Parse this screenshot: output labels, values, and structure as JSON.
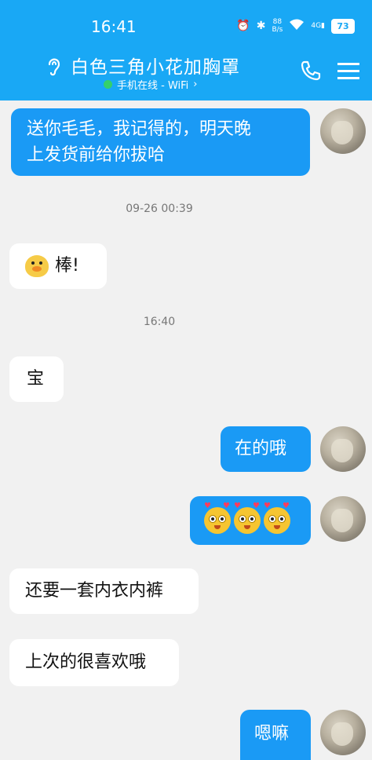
{
  "status_bar": {
    "time": "16:41",
    "net_speed_value": "88",
    "net_speed_unit": "B/s",
    "network": "4G",
    "battery": "73"
  },
  "header": {
    "title": "白色三角小花加胸罩",
    "online_status": "手机在线 - WiFi",
    "chevron": "›"
  },
  "messages": [
    {
      "side": "out",
      "text_line1": "送你毛毛，我记得的，明天晚",
      "text_line2": "上发货前给你拔哈"
    },
    {
      "type": "timestamp",
      "text": "09-26 00:39"
    },
    {
      "side": "in",
      "text": "棒!",
      "emoji": "duck-emoji"
    },
    {
      "type": "timestamp",
      "text": "16:40"
    },
    {
      "side": "in",
      "text": "宝"
    },
    {
      "side": "out",
      "text": "在的哦"
    },
    {
      "side": "out",
      "emoji": "heart-eyes-emoji x3"
    },
    {
      "side": "in",
      "text": "还要一套内衣内裤"
    },
    {
      "side": "in",
      "text": "上次的很喜欢哦"
    },
    {
      "side": "out",
      "text": "嗯嘛"
    }
  ],
  "colors": {
    "header": "#19a8f5",
    "outgoing_bubble": "#1a9af5",
    "incoming_bubble": "#ffffff",
    "background": "#f1f1f1"
  }
}
